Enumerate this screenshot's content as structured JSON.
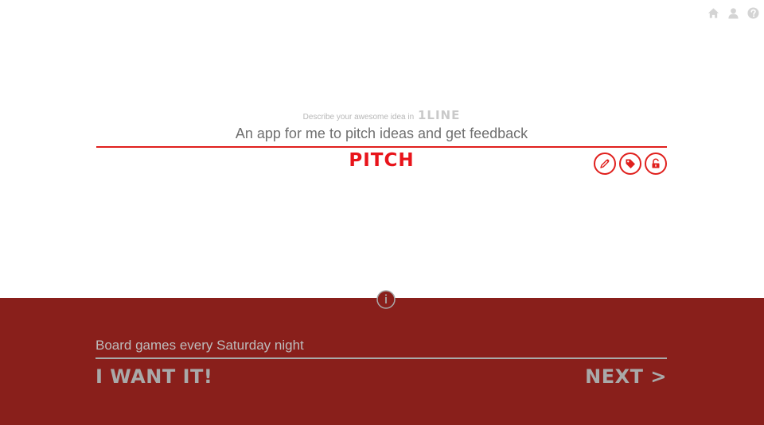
{
  "nav": {
    "icons": [
      "home-icon",
      "user-icon",
      "help-icon"
    ]
  },
  "pitch": {
    "prompt_text": "Describe your awesome idea in",
    "prompt_brand": "1LINE",
    "idea_value": "An app for me to pitch ideas and get feedback",
    "pitch_label": "PITCH",
    "option_icons": [
      "pencil-icon",
      "tag-icon",
      "unlock-icon"
    ]
  },
  "feed": {
    "current_idea": "Board games every Saturday night",
    "want_label": "I WANT IT!",
    "next_label": "NEXT >"
  },
  "colors": {
    "accent_red": "#e0201d",
    "band_red": "#891f1b",
    "muted_gray": "#a9a9a9"
  }
}
